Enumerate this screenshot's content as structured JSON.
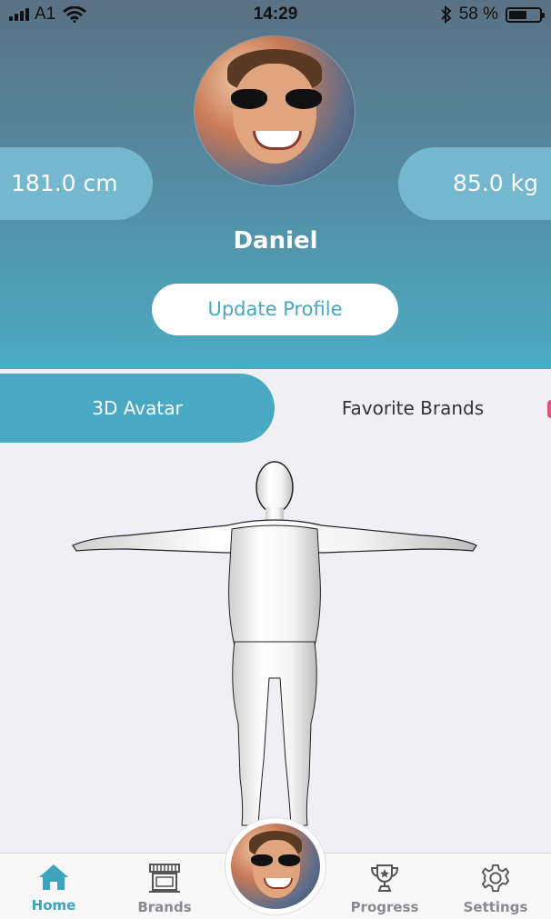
{
  "status_bar": {
    "carrier": "A1",
    "time": "14:29",
    "battery": "58 %",
    "battery_level": 0.58
  },
  "profile": {
    "height": "181.0 cm",
    "weight": "85.0 kg",
    "name": "Daniel",
    "update_button": "Update Profile"
  },
  "tabs": [
    {
      "label": "3D Avatar",
      "active": true
    },
    {
      "label": "Favorite Brands",
      "active": false
    }
  ],
  "bottom_nav": [
    {
      "label": "Home",
      "icon": "home-icon",
      "active": true
    },
    {
      "label": "Brands",
      "icon": "storefront-icon",
      "active": false
    },
    {
      "label": "Progress",
      "icon": "trophy-icon",
      "active": false
    },
    {
      "label": "Settings",
      "icon": "gear-icon",
      "active": false
    }
  ],
  "colors": {
    "accent": "#4aa9c2",
    "header_top": "#5a7183",
    "header_bottom": "#4cabc3",
    "pill": "#74b7cf"
  }
}
